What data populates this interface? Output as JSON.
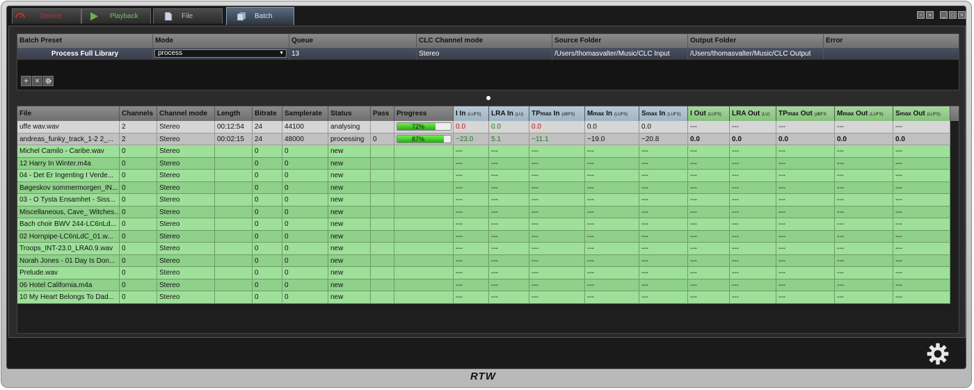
{
  "tabs": [
    {
      "label": "Device",
      "color": "#c03030"
    },
    {
      "label": "Playback",
      "color": "#6ab04c"
    },
    {
      "label": "File",
      "color": "#9ab0c0"
    },
    {
      "label": "Batch",
      "color": "#9ab0c0"
    }
  ],
  "preset": {
    "headers": [
      "Batch Preset",
      "Mode",
      "Queue",
      "CLC Channel mode",
      "Source Folder",
      "Output Folder",
      "Error"
    ],
    "row": {
      "name": "Process Full Library",
      "mode": "process",
      "queue": "13",
      "channel_mode": "Stereo",
      "source": "/Users/thomasvalter/Music/CLC Input",
      "output": "/Users/thomasvalter/Music/CLC Output",
      "error": ""
    }
  },
  "queue": {
    "headers": {
      "file": "File",
      "channels": "Channels",
      "channel_mode": "Channel mode",
      "length": "Length",
      "bitrate": "Bitrate",
      "samplerate": "Samplerate",
      "status": "Status",
      "pass": "Pass",
      "progress": "Progress",
      "i_in": "I In",
      "i_in_unit": "(LUFS)",
      "lra_in": "LRA In",
      "lra_in_unit": "(LU)",
      "tp_in_a": "TP",
      "tp_in_b": "max",
      "tp_in_c": " In",
      "tp_in_unit": "(dBFS)",
      "m_in_a": "M",
      "m_in_b": "max",
      "m_in_c": " In",
      "m_in_unit": "(LUFS)",
      "s_in_a": "S",
      "s_in_b": "max",
      "s_in_c": " In",
      "s_in_unit": "(LUFS)",
      "i_out": "I Out",
      "i_out_unit": "(LUFS)",
      "lra_out": "LRA Out",
      "lra_out_unit": "(LU)",
      "tp_out_a": "TP",
      "tp_out_b": "max",
      "tp_out_c": " Out",
      "tp_out_unit": "(dBFS",
      "m_out_a": "M",
      "m_out_b": "max",
      "m_out_c": " Out",
      "m_out_unit": "(LUFS)",
      "s_out_a": "S",
      "s_out_b": "max",
      "s_out_c": " Out",
      "s_out_unit": "(LUFS)"
    },
    "rows": [
      {
        "file": "uffe wav.wav",
        "channels": "2",
        "mode": "Stereo",
        "length": "00:12:54",
        "bitrate": "24",
        "samplerate": "44100",
        "status": "analysing",
        "pass": "",
        "progress": 72,
        "progress_label": "72%",
        "i_in": "0.0",
        "lra_in": "0.0",
        "tp_in": "0.0",
        "m_in": "0.0",
        "s_in": "0.0",
        "i_out": "---",
        "lra_out": "---",
        "tp_out": "---",
        "m_out": "---",
        "s_out": "---"
      },
      {
        "file": "andreas_funky_track_1-2 2_...",
        "channels": "2",
        "mode": "Stereo",
        "length": "00:02:15",
        "bitrate": "24",
        "samplerate": "48000",
        "status": "processing",
        "pass": "0",
        "progress": 87,
        "progress_label": "87%",
        "i_in": "−23.0",
        "lra_in": "5.1",
        "tp_in": "−11.1",
        "m_in": "−19.0",
        "s_in": "−20.8",
        "i_out": "0.0",
        "lra_out": "0.0",
        "tp_out": "0.0",
        "m_out": "0.0",
        "s_out": "0.0"
      },
      {
        "file": "Michel Camilo - Caribe.wav",
        "channels": "0",
        "mode": "Stereo",
        "length": "",
        "bitrate": "0",
        "samplerate": "0",
        "status": "new",
        "pass": "",
        "progress": 0,
        "progress_label": "",
        "i_in": "---",
        "lra_in": "---",
        "tp_in": "---",
        "m_in": "---",
        "s_in": "---",
        "i_out": "---",
        "lra_out": "---",
        "tp_out": "---",
        "m_out": "---",
        "s_out": "---"
      },
      {
        "file": "12 Harry In Winter.m4a",
        "channels": "0",
        "mode": "Stereo",
        "length": "",
        "bitrate": "0",
        "samplerate": "0",
        "status": "new",
        "pass": "",
        "progress": 0,
        "progress_label": "",
        "i_in": "---",
        "lra_in": "---",
        "tp_in": "---",
        "m_in": "---",
        "s_in": "---",
        "i_out": "---",
        "lra_out": "---",
        "tp_out": "---",
        "m_out": "---",
        "s_out": "---"
      },
      {
        "file": "04 - Det Er Ingenting I Verde...",
        "channels": "0",
        "mode": "Stereo",
        "length": "",
        "bitrate": "0",
        "samplerate": "0",
        "status": "new",
        "pass": "",
        "progress": 0,
        "progress_label": "",
        "i_in": "---",
        "lra_in": "---",
        "tp_in": "---",
        "m_in": "---",
        "s_in": "---",
        "i_out": "---",
        "lra_out": "---",
        "tp_out": "---",
        "m_out": "---",
        "s_out": "---"
      },
      {
        "file": "Bøgeskov sommermorgen_IN...",
        "channels": "0",
        "mode": "Stereo",
        "length": "",
        "bitrate": "0",
        "samplerate": "0",
        "status": "new",
        "pass": "",
        "progress": 0,
        "progress_label": "",
        "i_in": "---",
        "lra_in": "---",
        "tp_in": "---",
        "m_in": "---",
        "s_in": "---",
        "i_out": "---",
        "lra_out": "---",
        "tp_out": "---",
        "m_out": "---",
        "s_out": "---"
      },
      {
        "file": "03 - O Tysta Ensamhet - Siss...",
        "channels": "0",
        "mode": "Stereo",
        "length": "",
        "bitrate": "0",
        "samplerate": "0",
        "status": "new",
        "pass": "",
        "progress": 0,
        "progress_label": "",
        "i_in": "---",
        "lra_in": "---",
        "tp_in": "---",
        "m_in": "---",
        "s_in": "---",
        "i_out": "---",
        "lra_out": "---",
        "tp_out": "---",
        "m_out": "---",
        "s_out": "---"
      },
      {
        "file": "Miscellaneous, Cave_ Witches...",
        "channels": "0",
        "mode": "Stereo",
        "length": "",
        "bitrate": "0",
        "samplerate": "0",
        "status": "new",
        "pass": "",
        "progress": 0,
        "progress_label": "",
        "i_in": "---",
        "lra_in": "---",
        "tp_in": "---",
        "m_in": "---",
        "s_in": "---",
        "i_out": "---",
        "lra_out": "---",
        "tp_out": "---",
        "m_out": "---",
        "s_out": "---"
      },
      {
        "file": "Bach choir BWV 244-LC6nLd...",
        "channels": "0",
        "mode": "Stereo",
        "length": "",
        "bitrate": "0",
        "samplerate": "0",
        "status": "new",
        "pass": "",
        "progress": 0,
        "progress_label": "",
        "i_in": "---",
        "lra_in": "---",
        "tp_in": "---",
        "m_in": "---",
        "s_in": "---",
        "i_out": "---",
        "lra_out": "---",
        "tp_out": "---",
        "m_out": "---",
        "s_out": "---"
      },
      {
        "file": "02 Hornpipe-LC6nLdC_01.w...",
        "channels": "0",
        "mode": "Stereo",
        "length": "",
        "bitrate": "0",
        "samplerate": "0",
        "status": "new",
        "pass": "",
        "progress": 0,
        "progress_label": "",
        "i_in": "---",
        "lra_in": "---",
        "tp_in": "---",
        "m_in": "---",
        "s_in": "---",
        "i_out": "---",
        "lra_out": "---",
        "tp_out": "---",
        "m_out": "---",
        "s_out": "---"
      },
      {
        "file": "Troops_INT-23.0_LRA0.9.wav",
        "channels": "0",
        "mode": "Stereo",
        "length": "",
        "bitrate": "0",
        "samplerate": "0",
        "status": "new",
        "pass": "",
        "progress": 0,
        "progress_label": "",
        "i_in": "---",
        "lra_in": "---",
        "tp_in": "---",
        "m_in": "---",
        "s_in": "---",
        "i_out": "---",
        "lra_out": "---",
        "tp_out": "---",
        "m_out": "---",
        "s_out": "---"
      },
      {
        "file": "Norah Jones - 01 Day Is Don...",
        "channels": "0",
        "mode": "Stereo",
        "length": "",
        "bitrate": "0",
        "samplerate": "0",
        "status": "new",
        "pass": "",
        "progress": 0,
        "progress_label": "",
        "i_in": "---",
        "lra_in": "---",
        "tp_in": "---",
        "m_in": "---",
        "s_in": "---",
        "i_out": "---",
        "lra_out": "---",
        "tp_out": "---",
        "m_out": "---",
        "s_out": "---"
      },
      {
        "file": "Prelude.wav",
        "channels": "0",
        "mode": "Stereo",
        "length": "",
        "bitrate": "0",
        "samplerate": "0",
        "status": "new",
        "pass": "",
        "progress": 0,
        "progress_label": "",
        "i_in": "---",
        "lra_in": "---",
        "tp_in": "---",
        "m_in": "---",
        "s_in": "---",
        "i_out": "---",
        "lra_out": "---",
        "tp_out": "---",
        "m_out": "---",
        "s_out": "---"
      },
      {
        "file": "06 Hotel California.m4a",
        "channels": "0",
        "mode": "Stereo",
        "length": "",
        "bitrate": "0",
        "samplerate": "0",
        "status": "new",
        "pass": "",
        "progress": 0,
        "progress_label": "",
        "i_in": "---",
        "lra_in": "---",
        "tp_in": "---",
        "m_in": "---",
        "s_in": "---",
        "i_out": "---",
        "lra_out": "---",
        "tp_out": "---",
        "m_out": "---",
        "s_out": "---"
      },
      {
        "file": "10 My Heart Belongs To Dad...",
        "channels": "0",
        "mode": "Stereo",
        "length": "",
        "bitrate": "0",
        "samplerate": "0",
        "status": "new",
        "pass": "",
        "progress": 0,
        "progress_label": "",
        "i_in": "---",
        "lra_in": "---",
        "tp_in": "---",
        "m_in": "---",
        "s_in": "---",
        "i_out": "---",
        "lra_out": "---",
        "tp_out": "---",
        "m_out": "---",
        "s_out": "---"
      }
    ]
  },
  "icons": {
    "add": "plus-icon",
    "remove": "close-icon",
    "settings": "gear-icon",
    "main_settings": "gear-icon"
  },
  "brand": "RTW"
}
